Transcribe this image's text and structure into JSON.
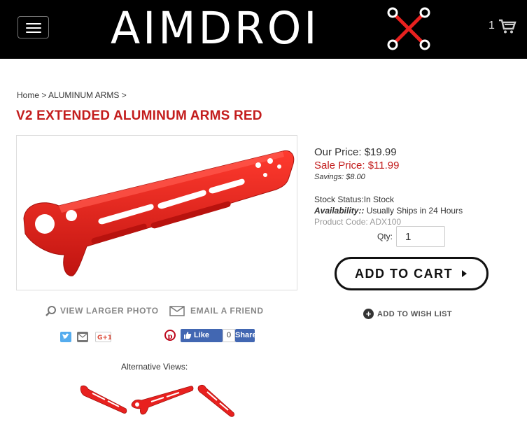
{
  "header": {
    "logo_text": "AIMDROI",
    "cart_count": "1",
    "menu_icon": "hamburger-menu-icon",
    "cart_icon": "shopping-cart-icon"
  },
  "breadcrumb": {
    "home": "Home",
    "sep1": ">",
    "category": "ALUMINUM ARMS",
    "sep2": ">"
  },
  "product": {
    "title": "V2 EXTENDED ALUMINUM ARMS RED",
    "our_price_label": "Our Price:",
    "our_price": "$19.99",
    "sale_price_label": "Sale Price:",
    "sale_price": "$11.99",
    "savings_label": "Savings:",
    "savings": "$8.00",
    "stock_label": "Stock Status:",
    "stock_value": "In Stock",
    "availability_label": "Availability::",
    "availability_value": "Usually Ships in 24 Hours",
    "code_label": "Product Code:",
    "code_value": "ADX100",
    "color": "#e8211f"
  },
  "purchase": {
    "qty_label": "Qty:",
    "qty_value": "1",
    "add_to_cart": "ADD TO CART",
    "wish_list": "ADD TO WISH LIST"
  },
  "media": {
    "view_larger": "VIEW LARGER PHOTO",
    "email_friend": "EMAIL A FRIEND",
    "alt_views_label": "Alternative Views:"
  },
  "social": {
    "fb_like": "Like",
    "fb_count": "0",
    "fb_share": "Share"
  },
  "colors": {
    "accent": "#c31d1d",
    "header_bg": "#000000"
  }
}
